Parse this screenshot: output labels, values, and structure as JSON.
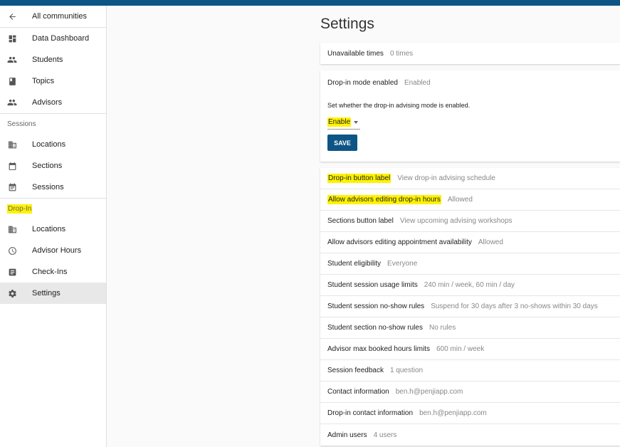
{
  "sidebar": {
    "back": {
      "label": "All communities",
      "icon": "arrow-left-icon"
    },
    "main_items": [
      {
        "label": "Data Dashboard",
        "icon": "dashboard-icon"
      },
      {
        "label": "Students",
        "icon": "people-icon"
      },
      {
        "label": "Topics",
        "icon": "book-icon"
      },
      {
        "label": "Advisors",
        "icon": "people-icon"
      }
    ],
    "sessions_header": "Sessions",
    "sessions_items": [
      {
        "label": "Locations",
        "icon": "building-icon"
      },
      {
        "label": "Sections",
        "icon": "calendar-icon"
      },
      {
        "label": "Sessions",
        "icon": "event-note-icon"
      }
    ],
    "dropin_header": "Drop-In",
    "dropin_items": [
      {
        "label": "Locations",
        "icon": "building-icon"
      },
      {
        "label": "Advisor Hours",
        "icon": "clock-icon"
      },
      {
        "label": "Check-Ins",
        "icon": "list-icon"
      },
      {
        "label": "Settings",
        "icon": "gear-icon",
        "active": true
      }
    ]
  },
  "page": {
    "title": "Settings"
  },
  "settings": {
    "unavailable": {
      "label": "Unavailable times",
      "value": "0 times"
    },
    "dropin_mode": {
      "label": "Drop-in mode enabled",
      "value": "Enabled",
      "description": "Set whether the drop-in advising mode is enabled.",
      "select_value": "Enable",
      "save_label": "SAVE"
    },
    "rows": [
      {
        "label": "Drop-in button label",
        "value": "View drop-in advising schedule"
      },
      {
        "label": "Allow advisors editing drop-in hours",
        "value": "Allowed"
      },
      {
        "label": "Sections button label",
        "value": "View upcoming advising workshops"
      },
      {
        "label": "Allow advisors editing appointment availability",
        "value": "Allowed"
      },
      {
        "label": "Student eligibility",
        "value": "Everyone"
      },
      {
        "label": "Student session usage limits",
        "value": "240 min / week, 60 min / day"
      },
      {
        "label": "Student session no-show rules",
        "value": "Suspend for 30 days after 3 no-shows within 30 days"
      },
      {
        "label": "Student section no-show rules",
        "value": "No rules"
      },
      {
        "label": "Advisor max booked hours limits",
        "value": "600 min / week"
      },
      {
        "label": "Session feedback",
        "value": "1 question"
      },
      {
        "label": "Contact information",
        "value": "ben.h@penjiapp.com"
      },
      {
        "label": "Drop-in contact information",
        "value": "ben.h@penjiapp.com"
      },
      {
        "label": "Admin users",
        "value": "4 users"
      }
    ]
  },
  "colors": {
    "primary": "#0d5585",
    "highlight": "#fff200"
  }
}
